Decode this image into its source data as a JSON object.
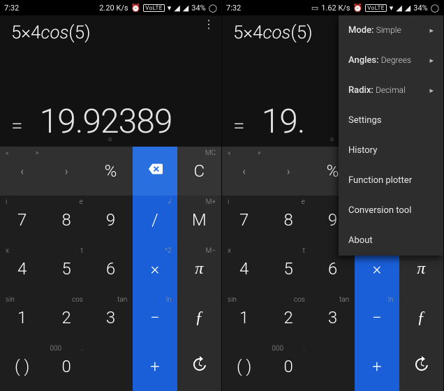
{
  "status": {
    "time": "7:32",
    "rate_left": "2.20 K/s",
    "rate_right": "1.62 K/s",
    "volte": "VoLTE",
    "battery": "34%"
  },
  "display": {
    "expression_a": "5×4",
    "expression_fn": "cos",
    "expression_b": "(5)",
    "equals": "=",
    "result": "19.92389",
    "result_cut": "19."
  },
  "row0": {
    "nav_sup_l1": "«",
    "nav_sup_r1": "»",
    "nav_main_l": "‹",
    "nav_main_r": "›",
    "pct": "%",
    "clear": "C",
    "sup_mc": "MC"
  },
  "keys": {
    "k7": "7",
    "k8": "8",
    "k9": "9",
    "div": "/",
    "M": "M",
    "k4": "4",
    "k5": "5",
    "k6": "6",
    "mul": "×",
    "pi": "π",
    "k1": "1",
    "k2": "2",
    "k3": "3",
    "sub": "−",
    "fn": "ƒ",
    "lp": "(",
    "rp": ")",
    "k0": "0",
    "add": "+"
  },
  "sups": {
    "i": "i",
    "e": "e",
    "sqrt": "√",
    "mplus": "M+",
    "x": "x",
    "t": "t",
    "caret2": "^2",
    "mminus": "M−",
    "sin": "sin",
    "cos": "cos",
    "tan": "tan",
    "ln": "ln",
    "tri": "000",
    "dot": "."
  },
  "menu": {
    "mode_label": "Mode:",
    "mode_value": "Simple",
    "angles_label": "Angles:",
    "angles_value": "Degrees",
    "radix_label": "Radix:",
    "radix_value": "Decimal",
    "settings": "Settings",
    "history": "History",
    "plotter": "Function plotter",
    "conv": "Conversion tool",
    "about": "About"
  }
}
